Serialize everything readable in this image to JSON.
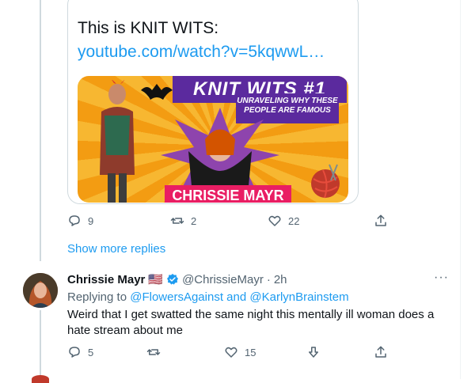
{
  "card": {
    "text_prefix": "This is KNIT WITS: ",
    "link": "youtube.com/watch?v=5kqwwL…",
    "media_title": "KNIT WITS #1",
    "media_subtitle": "UNRAVELING WHY THESE PEOPLE ARE FAMOUS",
    "media_name": "CHRISSIE MAYR"
  },
  "prev_actions": {
    "replies": "9",
    "retweets": "2",
    "likes": "22"
  },
  "show_more": "Show more replies",
  "tweet": {
    "name": "Chrissie Mayr",
    "flag": "🇺🇸",
    "handle": "@ChrissieMayr",
    "separator": "·",
    "time": "2h",
    "replying_prefix": "Replying to ",
    "reply_user1": "@FlowersAgainst",
    "reply_and": " and ",
    "reply_user2": "@KarlynBrainstem",
    "text": "Weird that I get swatted the same night this mentally ill woman does a hate stream about me",
    "more": "···",
    "actions": {
      "replies": "5",
      "retweets": "",
      "likes": "15"
    }
  },
  "colors": {
    "link": "#1d9bf0",
    "muted": "#536471",
    "verified": "#1d9bf0"
  },
  "icons": [
    "reply-icon",
    "retweet-icon",
    "like-icon",
    "share-icon",
    "downvote-icon",
    "verified-icon",
    "more-icon"
  ]
}
